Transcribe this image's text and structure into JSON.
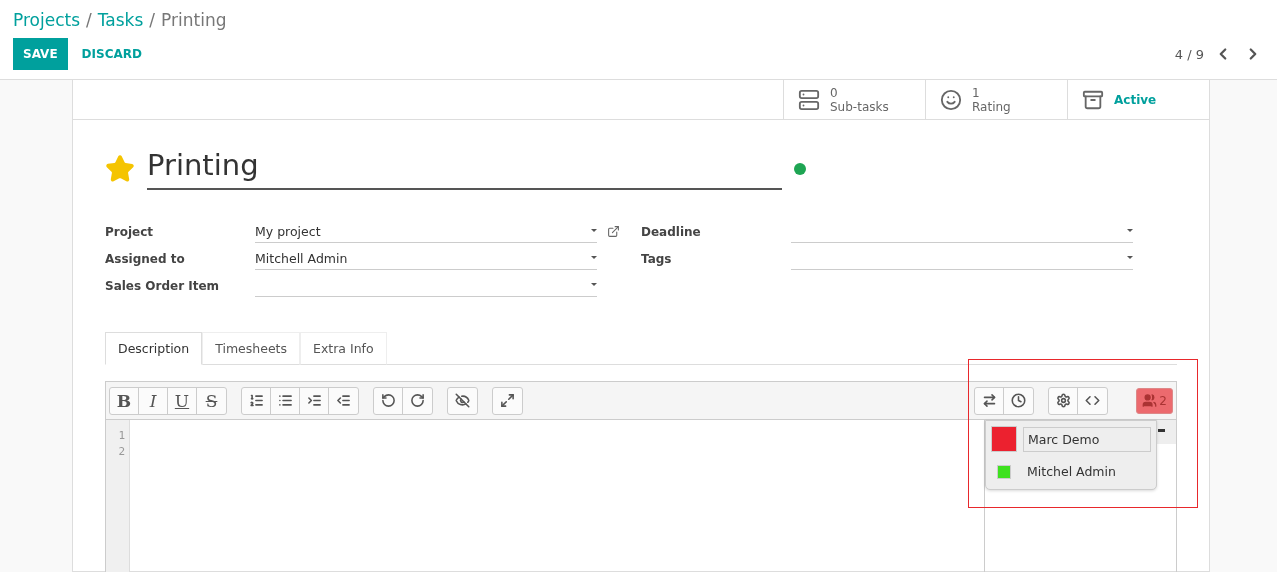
{
  "breadcrumb": [
    {
      "label": "Projects",
      "link": true
    },
    {
      "label": "Tasks",
      "link": true,
      "separator": "/"
    },
    {
      "label": "Printing",
      "link": false,
      "separator": "/"
    }
  ],
  "actions": {
    "save": "SAVE",
    "discard": "DISCARD"
  },
  "pager": {
    "value": "4 / 9"
  },
  "stat_buttons": [
    {
      "kind": "subtasks",
      "value": "0",
      "label": "Sub-tasks"
    },
    {
      "kind": "rating",
      "value": "1",
      "label": "Rating"
    },
    {
      "kind": "active",
      "label": "Active"
    }
  ],
  "title": {
    "text": "Printing",
    "favorite": true
  },
  "status_dot": {
    "color": "#1ea553"
  },
  "fields_left": [
    {
      "label": "Project",
      "value": "My project",
      "external_link": true
    },
    {
      "label": "Assigned to",
      "value": "Mitchell Admin",
      "external_link": false
    },
    {
      "label": "Sales Order Item",
      "external_link": false
    }
  ],
  "fields_right": [
    {
      "label": "Deadline"
    },
    {
      "label": "Tags"
    }
  ],
  "tabs": [
    {
      "label": "Description",
      "selected": true
    },
    {
      "label": "Timesheets",
      "selected": false
    },
    {
      "label": "Extra Info",
      "selected": false
    }
  ],
  "toolbar_left": [
    [
      {
        "kind": "bold",
        "text": "B"
      },
      {
        "kind": "italic",
        "text": "I"
      },
      {
        "kind": "underline",
        "text": "U"
      },
      {
        "kind": "strike",
        "text": "S"
      }
    ],
    [
      {
        "kind": "ol"
      },
      {
        "kind": "ul"
      },
      {
        "kind": "indent"
      },
      {
        "kind": "outdent"
      }
    ],
    [
      {
        "kind": "undo"
      },
      {
        "kind": "redo"
      }
    ],
    [
      {
        "kind": "hide"
      }
    ],
    [
      {
        "kind": "expand"
      }
    ]
  ],
  "toolbar_right": [
    [
      {
        "kind": "swap"
      },
      {
        "kind": "history"
      }
    ],
    [
      {
        "kind": "settings"
      },
      {
        "kind": "code"
      }
    ]
  ],
  "collab_button": {
    "count": "2"
  },
  "line_numbers": [
    "1",
    "2"
  ],
  "collaborators": [
    {
      "name": "Marc Demo",
      "color": "#ec212f",
      "selected": true
    },
    {
      "name": "Mitchel Admin",
      "color": "#3ee11f",
      "selected": false
    }
  ]
}
